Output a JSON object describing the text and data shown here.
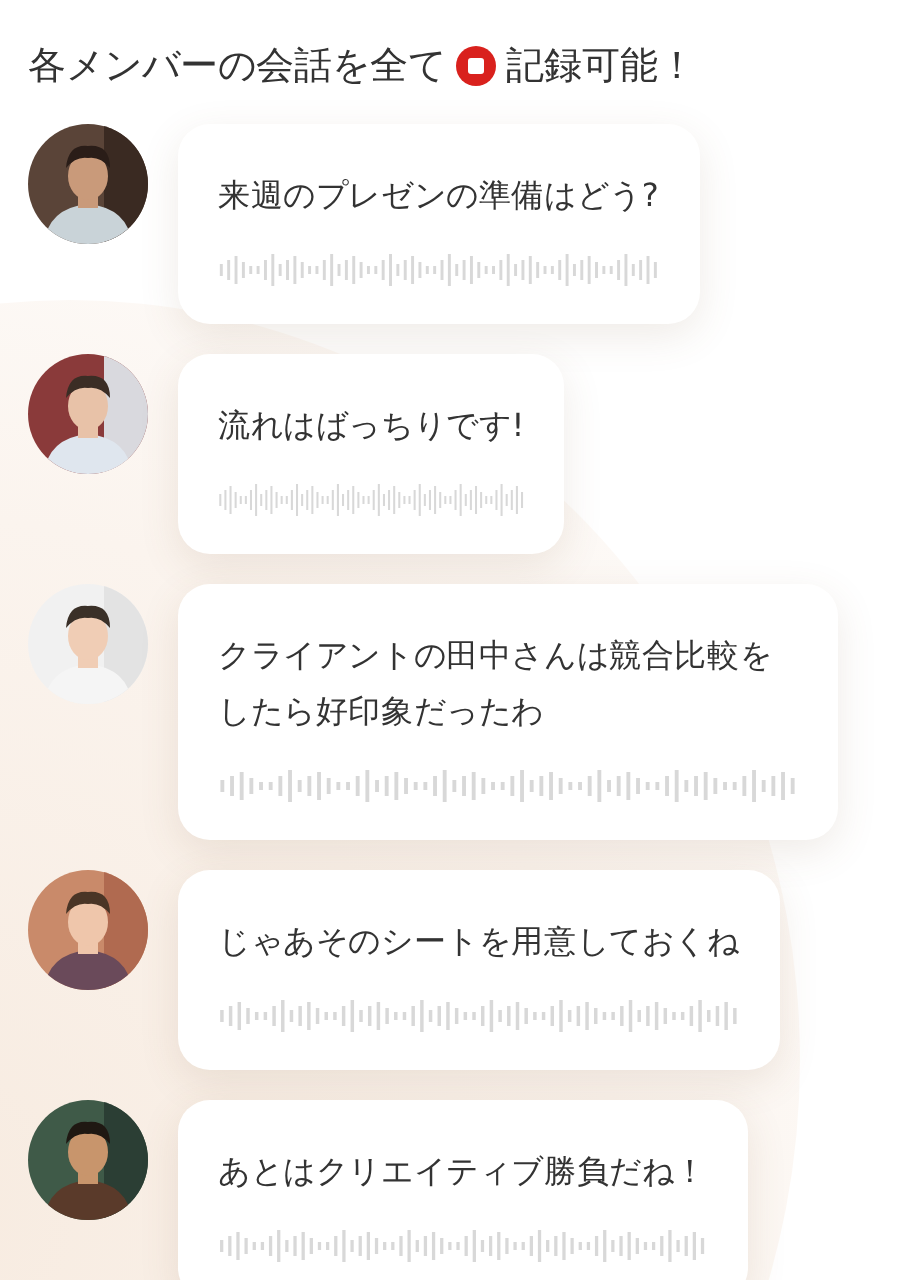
{
  "heading": {
    "before": "各メンバーの会話を全て",
    "after": "記録可能！"
  },
  "messages": [
    {
      "text": "来週のプレゼンの準備はどう?"
    },
    {
      "text": "流れはばっちりです!"
    },
    {
      "text": "クライアントの田中さんは競合比較をしたら好印象だったわ"
    },
    {
      "text": "じゃあそのシートを用意しておくね"
    },
    {
      "text": "あとはクリエイティブ勝負だね！"
    }
  ]
}
